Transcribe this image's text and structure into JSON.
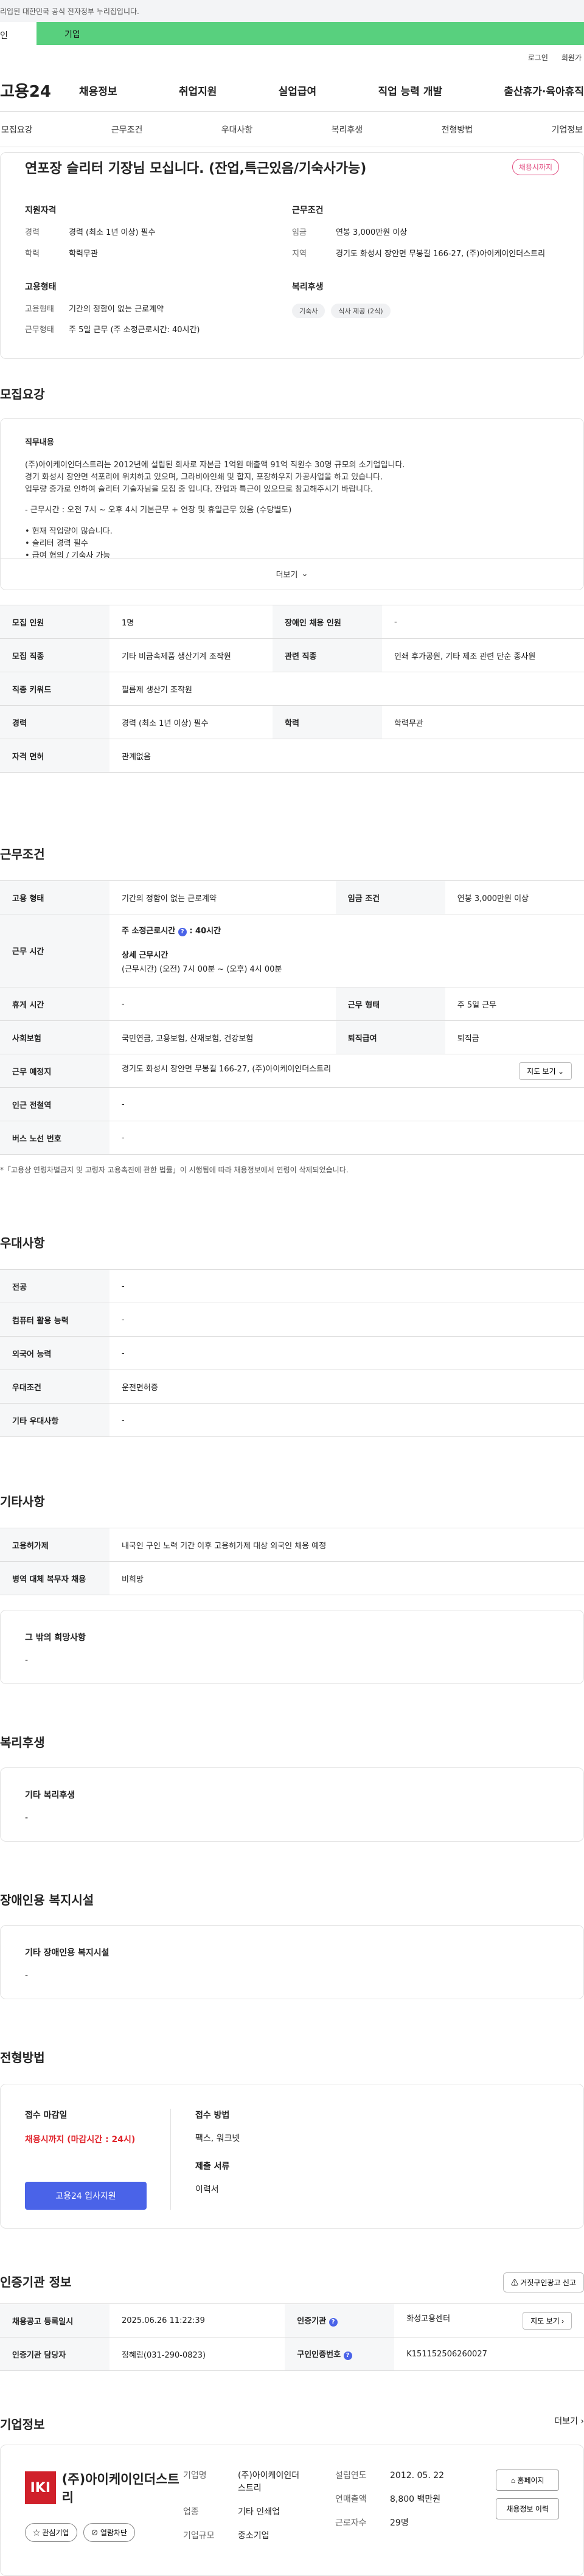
{
  "topbar": {
    "text": "리입된 대한민국 공식 전자정부 누리집입니다."
  },
  "site_tabs": {
    "person": "인",
    "company": "기업"
  },
  "util": {
    "login": "로그인",
    "join": "회원가"
  },
  "gnb": {
    "logo": "고용24",
    "items": [
      "채용정보",
      "취업지원",
      "실업급여",
      "직업 능력 개발",
      "출산휴가·육아휴직"
    ]
  },
  "lnb": {
    "items": [
      "모집요강",
      "근무조건",
      "우대사항",
      "복리후생",
      "전형방법",
      "기업정보"
    ]
  },
  "summary": {
    "title": "연포장 슬리터 기장님 모십니다. (잔업,특근있음/기숙사가능)",
    "badge": "채용시까지",
    "qual_title": "지원자격",
    "career_label": "경력",
    "career_value": "경력 (최소 1년 이상) 필수",
    "edu_label": "학력",
    "edu_value": "학력무관",
    "cond_title": "근무조건",
    "wage_label": "임금",
    "wage_value": "연봉 3,000만원 이상",
    "region_label": "지역",
    "region_value": "경기도 화성시 장안면 무봉길 166-27, (주)아이케이인더스트리",
    "emp_title": "고용형태",
    "emptype_label": "고용형태",
    "emptype_value": "기간의 정함이 없는 근로계약",
    "workform_label": "근무형태",
    "workform_value": "주 5일 근무 (주 소정근로시간: 40시간)",
    "welfare_title": "복리후생",
    "welfare_chips": [
      "기숙사",
      "식사 제공 (2식)"
    ]
  },
  "recruit": {
    "title": "모집요강",
    "desc_label": "직무내용",
    "desc_lines": [
      "(주)아이케이인더스트리는 2012년에 설립된 회사로 자본금 1억원 매출액 91억 직원수 30명 규모의 소기업입니다.",
      "경기 화성시 장안면 석포리에 위치하고 있으며, 그라비아인쇄 및 합지, 포장하우지 가공사업을 하고 있습니다.",
      "업무량 증가로 인하여 슬리터 기술자님을 모집 중 입니다. 잔업과 특근이 있으므로 참고해주시기 바랍니다.",
      "",
      "- 근무시간 : 오전 7시 ~ 오후 4시 기본근무 + 연장 및 휴일근무 있음 (수당별도)",
      "",
      "• 현재 작업량이 많습니다.",
      "• 슬리터 경력 필수",
      "• 급여 협의 / 기숙사 가능"
    ],
    "more": "더보기",
    "rows": [
      {
        "k1": "모집 인원",
        "v1": "1명",
        "k2": "장애인 채용 인원",
        "v2": "-"
      },
      {
        "k1": "모집 직종",
        "v1": "기타 비금속제품 생산기계 조작원",
        "k2": "관련 직종",
        "v2": "인쇄 후가공원, 기타 제조 관련 단순 종사원"
      },
      {
        "k1": "직종 키워드",
        "v1": "필름제 생산기 조작원",
        "k2": "",
        "v2": ""
      },
      {
        "k1": "경력",
        "v1": "경력 (최소 1년 이상) 필수",
        "k2": "학력",
        "v2": "학력무관"
      },
      {
        "k1": "자격 면허",
        "v1": "관계없음",
        "k2": "",
        "v2": ""
      }
    ]
  },
  "work": {
    "title": "근무조건",
    "emptype_k": "고용 형태",
    "emptype_v": "기간의 정함이 없는 근로계약",
    "wage_k": "임금 조건",
    "wage_v": "연봉 3,000만원 이상",
    "hours_k": "근무 시간",
    "hours_week": "주 소정근로시간",
    "hours_week_v": ": 40시간",
    "hours_detail_label": "상세 근무시간",
    "hours_detail": "(근무시간) (오전) 7시 00분 ~ (오후) 4시 00분",
    "rest_k": "휴게 시간",
    "rest_v": "-",
    "form_k": "근무 형태",
    "form_v": "주 5일 근무",
    "ins_k": "사회보험",
    "ins_v": "국민연금, 고용보험, 산재보험, 건강보험",
    "sev_k": "퇴직급여",
    "sev_v": "퇴직금",
    "place_k": "근무 예정지",
    "place_v": "경기도 화성시 장안면 무봉길 166-27, (주)아이케이인더스트리",
    "map_btn": "지도 보기",
    "subway_k": "인근 전철역",
    "subway_v": "-",
    "bus_k": "버스 노선 번호",
    "bus_v": "-",
    "note": "*「고용상 연령차별금지 및 고령자 고용촉진에 관한 법률」이 시행됨에 따라 채용정보에서 연령이 삭제되었습니다."
  },
  "pref": {
    "title": "우대사항",
    "rows": [
      {
        "k": "전공",
        "v": "-"
      },
      {
        "k": "컴퓨터 활용 능력",
        "v": "-"
      },
      {
        "k": "외국어 능력",
        "v": "-"
      },
      {
        "k": "우대조건",
        "v": "운전면허증"
      },
      {
        "k": "기타 우대사항",
        "v": "-"
      }
    ]
  },
  "etc": {
    "title": "기타사항",
    "rows": [
      {
        "k": "고용허가제",
        "v": "내국인 구인 노력 기간 이후 고용허가제 대상 외국인 채용 예정"
      },
      {
        "k": "병역 대체 복무자 채용",
        "v": "비희망"
      }
    ],
    "other_label": "그 밖의 희망사항",
    "other_value": "-"
  },
  "welfare": {
    "title": "복리후생",
    "label": "기타 복리후생",
    "value": "-"
  },
  "disabled": {
    "title": "장애인용 복지시설",
    "label": "기타 장애인용 복지시설",
    "value": "-"
  },
  "apply": {
    "title": "전형방법",
    "deadline_label": "접수 마감일",
    "deadline_value": "채용시까지 (마감시간 : 24시)",
    "apply_btn": "고용24 입사지원",
    "method_label": "접수 방법",
    "method_value": "팩스, 워크넷",
    "docs_label": "제출 서류",
    "docs_value": "이력서"
  },
  "cert": {
    "title": "인증기관 정보",
    "report_btn": "거짓구인광고 신고",
    "reg_k": "채용공고 등록일시",
    "reg_v": "2025.06.26 11:22:39",
    "agency_k": "인증기관",
    "agency_v": "화성고용센터",
    "map_btn": "지도 보기",
    "manager_k": "인증기관 담당자",
    "manager_v": "정혜림(031-290-0823)",
    "num_k": "구인인증번호",
    "num_v": "K151152506260027"
  },
  "company": {
    "title": "기업정보",
    "more": "더보기",
    "logo_mark": "IKI",
    "logo_name": "(주)아이케이인더스트리",
    "fav_btn": "관심기업",
    "block_btn": "열람차단",
    "name_k": "기업명",
    "name_v": "(주)아이케이인더스트리",
    "biz_k": "업종",
    "biz_v": "기타 인쇄업",
    "size_k": "기업규모",
    "size_v": "중소기업",
    "est_k": "설립연도",
    "est_v": "2012. 05. 22",
    "sales_k": "연매출액",
    "sales_v": "8,800 백만원",
    "emp_k": "근로자수",
    "emp_v": "29명",
    "home_btn": "홈페이지",
    "history_btn": "채용정보 이력"
  }
}
